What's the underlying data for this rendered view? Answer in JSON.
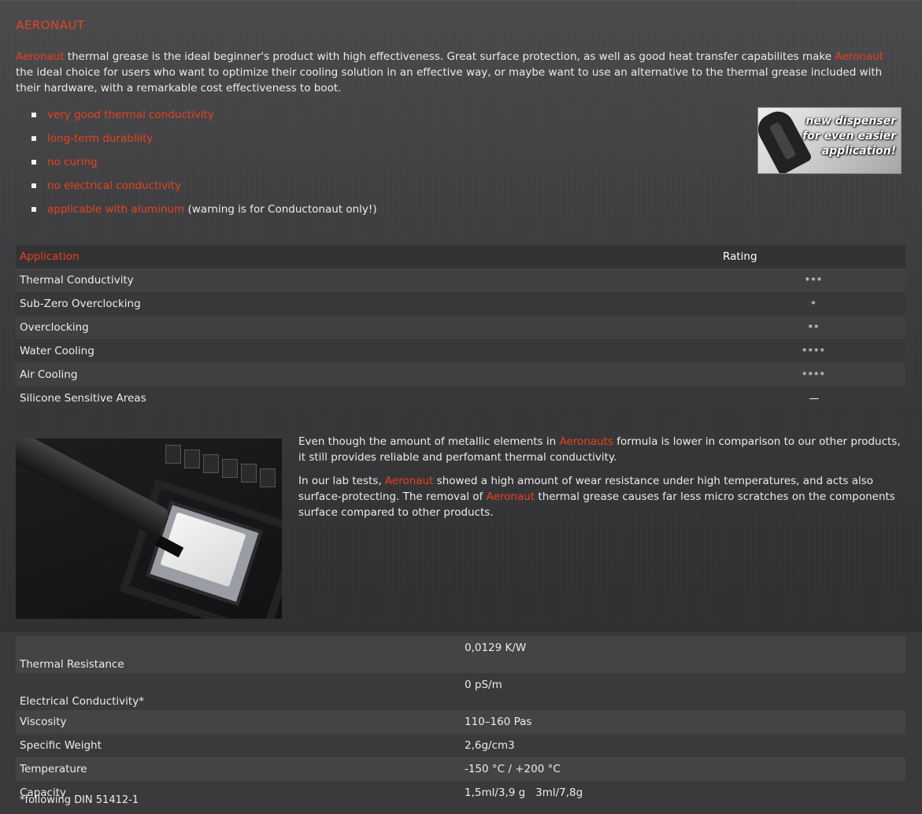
{
  "heading": "AERONAUT",
  "intro": {
    "brand": "Aeronaut",
    "text1": " thermal grease is the ideal beginner's product with high effectiveness. Great surface protection, as well as good heat transfer capabilites make ",
    "text2": " the ideal choice for users who want to optimize their cooling solution in an effective way, or maybe want to use an alternative to the thermal grease included with their hardware, with a remarkable cost effectiveness to boot."
  },
  "features": [
    {
      "label": "very good thermal conductivity",
      "note": ""
    },
    {
      "label": "long-term durability",
      "note": ""
    },
    {
      "label": "no curing",
      "note": ""
    },
    {
      "label": "no electrical conductivity",
      "note": ""
    },
    {
      "label": "applicable with aluminum",
      "note": " (warning is for Conductonaut only!)"
    }
  ],
  "promo": {
    "line1": "new dispenser",
    "line2": "for even easier",
    "line3": "application!"
  },
  "rating_table": {
    "header": {
      "application": "Application",
      "rating": "Rating"
    },
    "rows": [
      {
        "application": "Thermal Conductivity",
        "rating": "***"
      },
      {
        "application": "Sub-Zero Overclocking",
        "rating": "*"
      },
      {
        "application": "Overclocking",
        "rating": "**"
      },
      {
        "application": "Water Cooling",
        "rating": "****"
      },
      {
        "application": "Air Cooling",
        "rating": "****"
      },
      {
        "application": "Silicone Sensitive Areas",
        "rating": "—"
      }
    ]
  },
  "paragraphs": {
    "p1": {
      "a": "Even though the amount of metallic elements in ",
      "brand": "Aeronauts",
      "b": " formula is lower in comparison to our other products, it still provides reliable and perfomant thermal conductivity."
    },
    "p2": {
      "a": "In our lab tests, ",
      "brand1": "Aeronaut",
      "b": " showed a high amount of wear resistance under high temperatures, and acts also surface-protecting. The removal of ",
      "brand2": "Aeronaut",
      "c": " thermal grease causes far less micro scratches on the components surface compared to other products."
    }
  },
  "specs": [
    {
      "name": "Thermal Resistance",
      "value": "0,0129 K/W"
    },
    {
      "name": "Electrical Conductivity*",
      "value": "0 pS/m"
    },
    {
      "name": "Viscosity",
      "value": "110–160 Pas"
    },
    {
      "name": "Specific Weight",
      "value": "2,6g/cm3"
    },
    {
      "name": "Temperature",
      "value": "-150 °C / +200 °C"
    },
    {
      "name": "Capacity",
      "value": "1,5ml/3,9 g   3ml/7,8g"
    }
  ],
  "footnote": "*following DIN 51412-1",
  "colors": {
    "accent": "#e8421f",
    "background": "#3a3a3b"
  }
}
